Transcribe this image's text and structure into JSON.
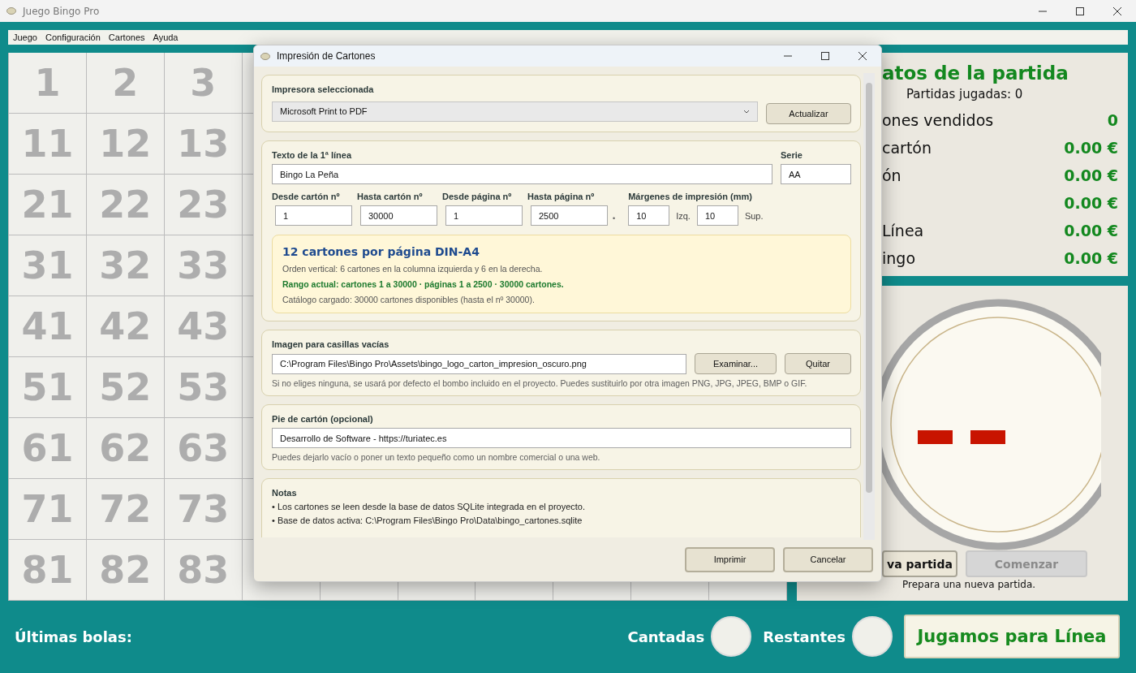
{
  "window": {
    "title": "Juego Bingo Pro"
  },
  "menu": [
    {
      "label": "Juego"
    },
    {
      "label": "Configuración"
    },
    {
      "label": "Cartones"
    },
    {
      "label": "Ayuda"
    }
  ],
  "board": {
    "rows": [
      [
        "1",
        "2",
        "3"
      ],
      [
        "11",
        "12",
        "13"
      ],
      [
        "21",
        "22",
        "23"
      ],
      [
        "31",
        "32",
        "33"
      ],
      [
        "41",
        "42",
        "43"
      ],
      [
        "51",
        "52",
        "53"
      ],
      [
        "61",
        "62",
        "63"
      ],
      [
        "71",
        "72",
        "73"
      ],
      [
        "81",
        "82",
        "83"
      ]
    ]
  },
  "stats": {
    "title": "atos de la partida",
    "subtitle": "Partidas jugadas: 0",
    "rows": [
      {
        "label": "ones vendidos",
        "value": "0"
      },
      {
        "label": "cartón",
        "value": "0.00 €"
      },
      {
        "label": "ón",
        "value": "0.00 €"
      },
      {
        "value": "0.00 €"
      },
      {
        "label": "Línea",
        "value": "0.00 €"
      },
      {
        "label": "ingo",
        "value": "0.00 €"
      }
    ]
  },
  "game_buttons": [
    {
      "label": "va partida",
      "disabled": false
    },
    {
      "label": "Comenzar",
      "disabled": true
    }
  ],
  "status": "Prepara una nueva partida.",
  "bottom": {
    "last_balls": "Últimas bolas:",
    "counters": [
      {
        "label": "Cantadas"
      },
      {
        "label": "Restantes"
      }
    ],
    "mode_button": "Jugamos para Línea"
  },
  "dialog": {
    "title": "Impresión de Cartones",
    "printer": {
      "label": "Impresora seleccionada",
      "value": "Microsoft Print to PDF",
      "button": "Actualizar"
    },
    "text_line": {
      "label": "Texto de la 1ª línea",
      "value": "Bingo La Peña"
    },
    "series": {
      "label": "Serie",
      "value": "AA"
    },
    "ranges": [
      {
        "label": "Desde cartón nº",
        "value": "1"
      },
      {
        "label": "Hasta cartón nº",
        "value": "30000"
      },
      {
        "label": "Desde página nº",
        "value": "1"
      },
      {
        "label": "Hasta página nº",
        "value": "2500"
      }
    ],
    "separator": "•",
    "margins": {
      "label": "Márgenes de impresión (mm)",
      "fields": [
        {
          "value": "10",
          "unit": "Izq."
        },
        {
          "value": "10",
          "unit": "Sup."
        }
      ]
    },
    "info": {
      "title": "12 cartones por página DIN-A4",
      "lines": [
        {
          "text": "Orden vertical: 6 cartones en la columna izquierda y 6 en la derecha.",
          "highlight": false
        },
        {
          "text": "Rango actual: cartones 1 a 30000 · páginas 1 a 2500 · 30000 cartones.",
          "highlight": true
        },
        {
          "text": "Catálogo cargado: 30000 cartones disponibles (hasta el nº 30000).",
          "highlight": false
        }
      ]
    },
    "image": {
      "label": "Imagen para casillas vacías",
      "value": "C:\\Program Files\\Bingo Pro\\Assets\\bingo_logo_carton_impresion_oscuro.png",
      "buttons": [
        "Examinar...",
        "Quitar"
      ],
      "hint": "Si no eliges ninguna, se usará por defecto el bombo incluido en el proyecto. Puedes sustituirlo por otra imagen PNG, JPG, JPEG, BMP o GIF."
    },
    "footer": {
      "label": "Pie de cartón (opcional)",
      "value": "Desarrollo de Software - https://turiatec.es",
      "hint": "Puedes dejarlo vacío o poner un texto pequeño como un nombre comercial o una web."
    },
    "notes": {
      "label": "Notas",
      "items": [
        "• Los cartones se leen desde la base de datos SQLite integrada en el proyecto.",
        "• Base de datos activa: C:\\Program Files\\Bingo Pro\\Data\\bingo_cartones.sqlite"
      ]
    },
    "actions": [
      "Imprimir",
      "Cancelar"
    ]
  }
}
